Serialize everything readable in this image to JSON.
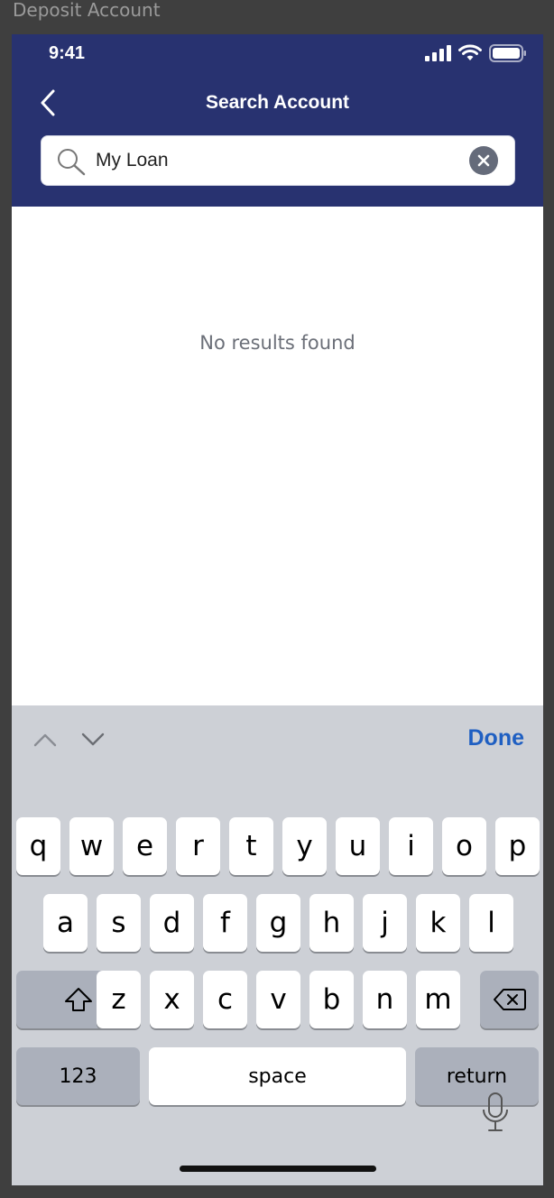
{
  "frame": {
    "label": "Deposit Account"
  },
  "status_bar": {
    "time": "9:41"
  },
  "header": {
    "title": "Search Account"
  },
  "search": {
    "value": "My Loan",
    "placeholder": ""
  },
  "results": {
    "empty_message": "No results found"
  },
  "keyboard": {
    "done_label": "Done",
    "row1": [
      "q",
      "w",
      "e",
      "r",
      "t",
      "y",
      "u",
      "i",
      "o",
      "p"
    ],
    "row2": [
      "a",
      "s",
      "d",
      "f",
      "g",
      "h",
      "j",
      "k",
      "l"
    ],
    "row3": [
      "z",
      "x",
      "c",
      "v",
      "b",
      "n",
      "m"
    ],
    "numbers_label": "123",
    "space_label": "space",
    "return_label": "return"
  },
  "colors": {
    "header_bg": "#283270",
    "keyboard_bg": "#cdd0d6",
    "accent": "#1f5fc2"
  }
}
